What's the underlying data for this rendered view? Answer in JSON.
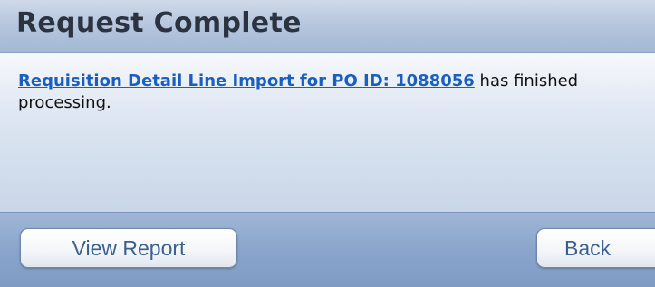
{
  "dialog": {
    "title": "Request Complete",
    "message": {
      "link_text": "Requisition Detail Line Import for PO ID: 1088056",
      "trailing_text": " has finished processing."
    },
    "buttons": {
      "view_report": "View Report",
      "back": "Back"
    }
  },
  "colors": {
    "title_text": "#2b3340",
    "link": "#1a5ec0",
    "button_text": "#3b5f8f",
    "footer_bg": "#8aa5cc",
    "titlebar_bg": "#b3c4dd"
  }
}
